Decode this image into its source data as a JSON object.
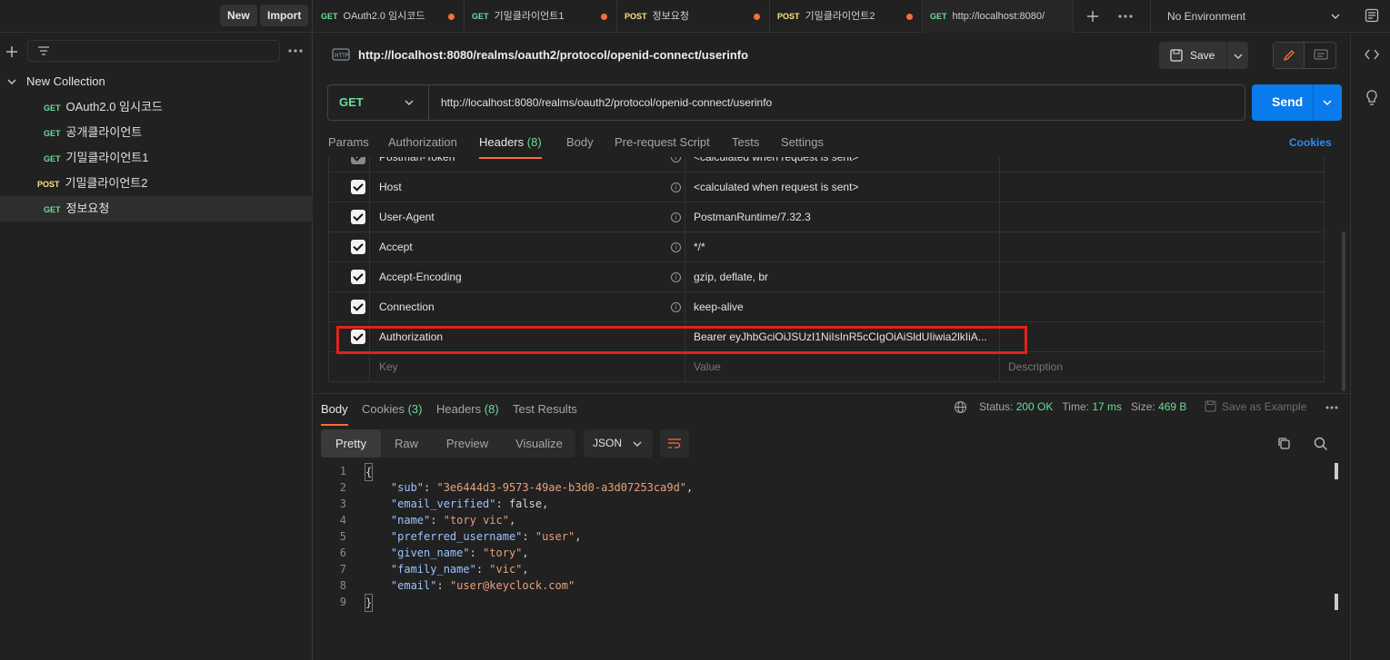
{
  "sidebar": {
    "new_label": "New",
    "import_label": "Import",
    "collection_name": "New Collection",
    "items": [
      {
        "method": "GET",
        "name": "OAuth2.0 임시코드"
      },
      {
        "method": "GET",
        "name": "공개클라이언트"
      },
      {
        "method": "GET",
        "name": "기밀클라이언트1"
      },
      {
        "method": "POST",
        "name": "기밀클라이언트2"
      },
      {
        "method": "GET",
        "name": "정보요청"
      }
    ]
  },
  "tabs": [
    {
      "method": "GET",
      "name": "OAuth2.0 임시코드"
    },
    {
      "method": "GET",
      "name": "기밀클라이언트1"
    },
    {
      "method": "POST",
      "name": "정보요청"
    },
    {
      "method": "POST",
      "name": "기밀클라이언트2"
    },
    {
      "method": "GET",
      "name": "http://localhost:8080/"
    }
  ],
  "environment": "No Environment",
  "request": {
    "title": "http://localhost:8080/realms/oauth2/protocol/openid-connect/userinfo",
    "save_label": "Save",
    "method": "GET",
    "url": "http://localhost:8080/realms/oauth2/protocol/openid-connect/userinfo",
    "send_label": "Send",
    "tabs": {
      "params": "Params",
      "authorization": "Authorization",
      "headers": "Headers",
      "headers_count": "(8)",
      "body": "Body",
      "prerequest": "Pre-request Script",
      "tests": "Tests",
      "settings": "Settings"
    },
    "cookies_link": "Cookies"
  },
  "headers_table": {
    "rows": [
      {
        "key": "Postman-Token",
        "value": "<calculated when request is sent>"
      },
      {
        "key": "Host",
        "value": "<calculated when request is sent>"
      },
      {
        "key": "User-Agent",
        "value": "PostmanRuntime/7.32.3"
      },
      {
        "key": "Accept",
        "value": "*/*"
      },
      {
        "key": "Accept-Encoding",
        "value": "gzip, deflate, br"
      },
      {
        "key": "Connection",
        "value": "keep-alive"
      },
      {
        "key": "Authorization",
        "value": "Bearer eyJhbGciOiJSUzI1NiIsInR5cCIgOiAiSldUIiwia2lkIiA..."
      }
    ],
    "placeholder_key": "Key",
    "placeholder_value": "Value",
    "placeholder_description": "Description"
  },
  "response": {
    "tabs": {
      "body": "Body",
      "cookies": "Cookies",
      "cookies_count": "(3)",
      "headers": "Headers",
      "headers_count": "(8)",
      "test_results": "Test Results"
    },
    "status_label": "Status:",
    "status_value": "200 OK",
    "time_label": "Time:",
    "time_value": "17 ms",
    "size_label": "Size:",
    "size_value": "469 B",
    "save_example": "Save as Example",
    "formats": [
      "Pretty",
      "Raw",
      "Preview",
      "Visualize"
    ],
    "language": "JSON",
    "json": {
      "sub": "\"3e6444d3-9573-49ae-b3d0-a3d07253ca9d\"",
      "email_verified": "false",
      "name": "\"tory vic\"",
      "preferred_username": "\"user\"",
      "given_name": "\"tory\"",
      "family_name": "\"vic\"",
      "email": "\"user@keyclock.com\""
    },
    "line_numbers": [
      "1",
      "2",
      "3",
      "4",
      "5",
      "6",
      "7",
      "8",
      "9"
    ]
  },
  "colors": {
    "get": "#6bdd9a",
    "post": "#ffe47e",
    "accent": "#ff6c37",
    "send": "#097bed",
    "highlight": "#e2231a"
  }
}
